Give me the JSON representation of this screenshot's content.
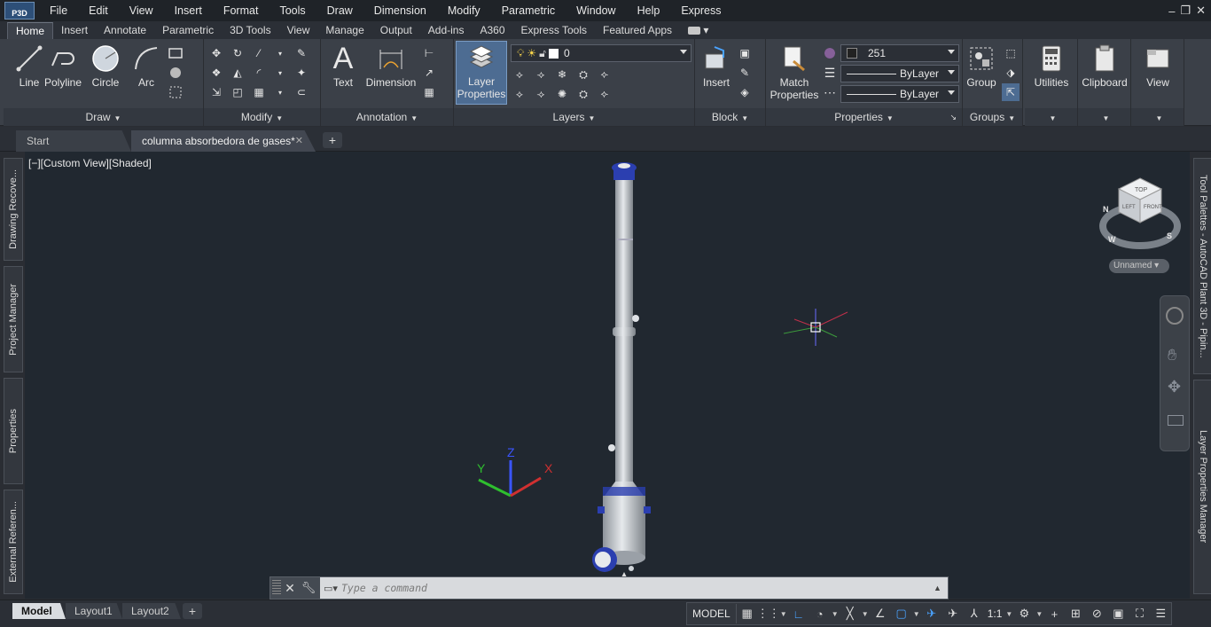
{
  "app": {
    "logo_text": "P3D"
  },
  "menu": [
    "File",
    "Edit",
    "View",
    "Insert",
    "Format",
    "Tools",
    "Draw",
    "Dimension",
    "Modify",
    "Parametric",
    "Window",
    "Help",
    "Express"
  ],
  "ribbon_tabs": [
    "Home",
    "Insert",
    "Annotate",
    "Parametric",
    "3D Tools",
    "View",
    "Manage",
    "Output",
    "Add-ins",
    "A360",
    "Express Tools",
    "Featured Apps"
  ],
  "ribbon": {
    "draw": {
      "title": "Draw",
      "line": "Line",
      "polyline": "Polyline",
      "circle": "Circle",
      "arc": "Arc"
    },
    "modify": {
      "title": "Modify"
    },
    "annotation": {
      "title": "Annotation",
      "text": "Text",
      "dimension": "Dimension"
    },
    "layers": {
      "title": "Layers",
      "layer_properties_1": "Layer",
      "layer_properties_2": "Properties",
      "current_layer": "0"
    },
    "block": {
      "title": "Block",
      "insert": "Insert"
    },
    "properties": {
      "title": "Properties",
      "match_1": "Match",
      "match_2": "Properties",
      "color_value": "251",
      "linetype": "ByLayer",
      "lineweight": "ByLayer"
    },
    "groups": {
      "title": "Groups",
      "group": "Group"
    },
    "utilities": {
      "label": "Utilities"
    },
    "clipboard": {
      "label": "Clipboard"
    },
    "view": {
      "label": "View"
    }
  },
  "doc_tabs": {
    "start": "Start",
    "active": "columna absorbedora de gases*",
    "close": "✕",
    "add": "+"
  },
  "viewport": {
    "label": "[−][Custom View][Shaded]",
    "viewcube": {
      "top": "TOP",
      "left": "LEFT",
      "front": "FRONT",
      "north": "N",
      "west": "W",
      "south": "S"
    },
    "view_name": "Unnamed",
    "ucs": {
      "x": "X",
      "y": "Y",
      "z": "Z"
    }
  },
  "side_palettes": {
    "left": [
      "Drawing Recove...",
      "Project Manager",
      "Properties",
      "External Referen..."
    ],
    "right": [
      "Tool Palettes - AutoCAD Plant 3D - Pipin...",
      "Layer Properties Manager"
    ]
  },
  "command_line": {
    "placeholder": "Type a command"
  },
  "layout_tabs": [
    "Model",
    "Layout1",
    "Layout2"
  ],
  "status": {
    "model": "MODEL",
    "scale": "1:1"
  },
  "colors": {
    "accent": "#4d6c92",
    "viewport_bg": "#212830",
    "ribbon_bg": "#3b4048"
  }
}
